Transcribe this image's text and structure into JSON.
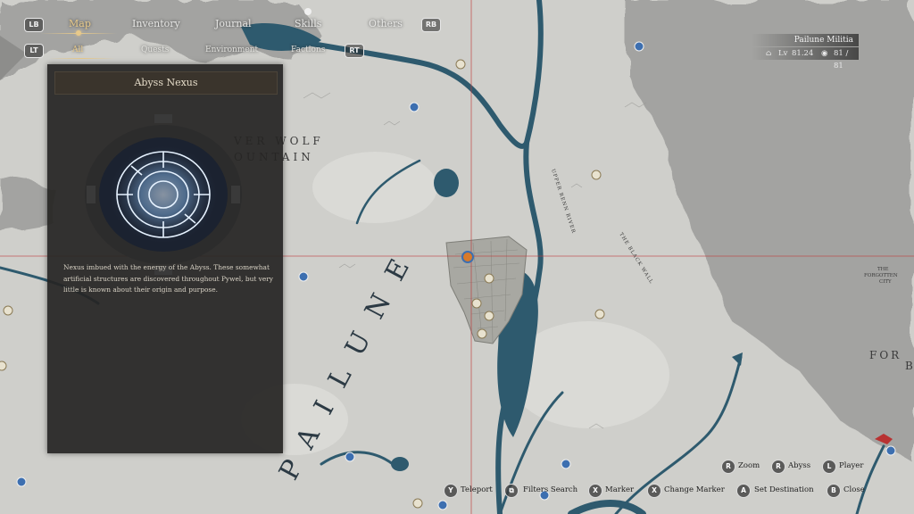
{
  "nav": {
    "lb": "LB",
    "rb": "RB",
    "lt": "LT",
    "rt": "RT",
    "tabs": [
      "Map",
      "Inventory",
      "Journal",
      "Skills",
      "Others"
    ],
    "subtabs": [
      "All",
      "Quests",
      "Environment",
      "Factions"
    ]
  },
  "panel": {
    "title": "Abyss Nexus",
    "description": "Nexus imbued with the energy of the Abyss. These somewhat artificial structures are discovered throughout Pywel, but very little is known about their origin and purpose."
  },
  "region": {
    "name": "Pailune Militia",
    "level_label": "Lv",
    "level": "81.24",
    "count": "81 / 81"
  },
  "map_labels": {
    "region_name": "PAILUNE",
    "mountain_1": "VER WOLF",
    "mountain_2": "OUNTAIN",
    "river_1": "UPPER RENN RIVER",
    "area_1": "THE BLACK WALL",
    "area_2a": "THE",
    "area_2b": "FORGOTTEN",
    "area_2c": "CITY",
    "edge_1": "FOR",
    "edge_2": "B"
  },
  "prompts": [
    {
      "key": "R",
      "label": "Zoom"
    },
    {
      "key": "R",
      "label": "Abyss"
    },
    {
      "key": "L",
      "label": "Player"
    },
    {
      "key": "Y",
      "label": "Teleport"
    },
    {
      "key": "⧉",
      "label": "Filters Search"
    },
    {
      "key": "X",
      "label": "Marker"
    },
    {
      "key": "X",
      "label": "Change Marker"
    },
    {
      "key": "A",
      "label": "Set Destination"
    },
    {
      "key": "B",
      "label": "Close"
    }
  ],
  "colors": {
    "water": "#2e5a6e",
    "land": "#cfcfcb",
    "fog": "#9e9e9c",
    "accent": "#e7c98a",
    "crosshair": "#c03a3a"
  }
}
